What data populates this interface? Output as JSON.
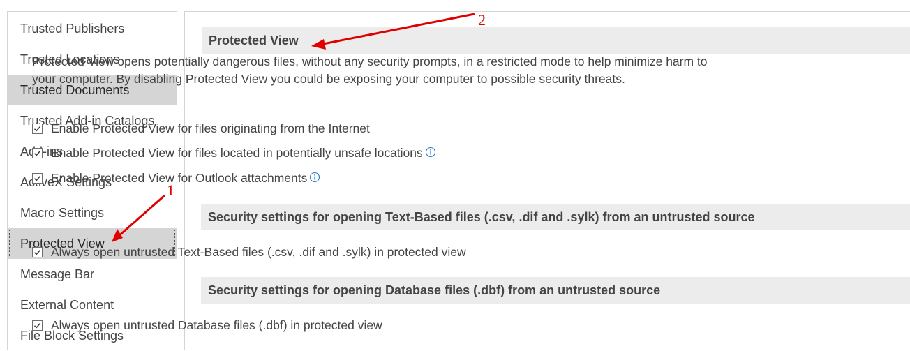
{
  "sidebar": {
    "items": [
      {
        "label": "Trusted Publishers"
      },
      {
        "label": "Trusted Locations"
      },
      {
        "label": "Trusted Documents"
      },
      {
        "label": "Trusted Add-in Catalogs"
      },
      {
        "label": "Add-ins"
      },
      {
        "label": "ActiveX Settings"
      },
      {
        "label": "Macro Settings"
      },
      {
        "label": "Protected View"
      },
      {
        "label": "Message Bar"
      },
      {
        "label": "External Content"
      },
      {
        "label": "File Block Settings"
      }
    ],
    "selected": "Protected View",
    "highlighted": "Trusted Documents"
  },
  "main": {
    "protected_view": {
      "title": "Protected View",
      "description": "Protected View opens potentially dangerous files, without any security prompts, in a restricted mode to help minimize harm to your computer. By disabling Protected View you could be exposing your computer to possible security threats.",
      "options": [
        {
          "label": "Enable Protected View for files originating from the Internet",
          "checked": true,
          "info": false
        },
        {
          "label": "Enable Protected View for files located in potentially unsafe locations",
          "checked": true,
          "info": true
        },
        {
          "label": "Enable Protected View for Outlook attachments",
          "checked": true,
          "info": true
        }
      ]
    },
    "text_based": {
      "title": "Security settings for opening Text-Based files (.csv, .dif and .sylk) from an untrusted source",
      "options": [
        {
          "label": "Always open untrusted Text-Based files (.csv, .dif and .sylk) in protected view",
          "checked": true
        }
      ]
    },
    "database": {
      "title": "Security settings for opening Database files (.dbf) from an untrusted source",
      "options": [
        {
          "label": "Always open untrusted Database files (.dbf) in protected view",
          "checked": true
        }
      ]
    }
  },
  "annotations": {
    "marker_1": "1",
    "marker_2": "2",
    "color": "#e00000"
  },
  "icons": {
    "check": "checkmark-icon",
    "info": "info-icon"
  }
}
